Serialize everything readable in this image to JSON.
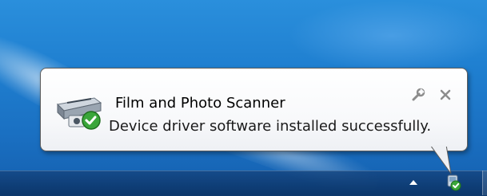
{
  "notification": {
    "title": "Film and Photo Scanner",
    "message": "Device driver software installed successfully."
  },
  "icons": {
    "app": "scanner-check-icon",
    "options": "wrench-icon",
    "close": "close-icon",
    "tray_overflow": "tray-up-arrow-icon",
    "tray_device": "device-check-icon"
  },
  "colors": {
    "desktop_blue": "#1f7fd0",
    "taskbar": "#0f3f7a",
    "success_green": "#3aa63a",
    "balloon_bg": "#ffffff"
  }
}
